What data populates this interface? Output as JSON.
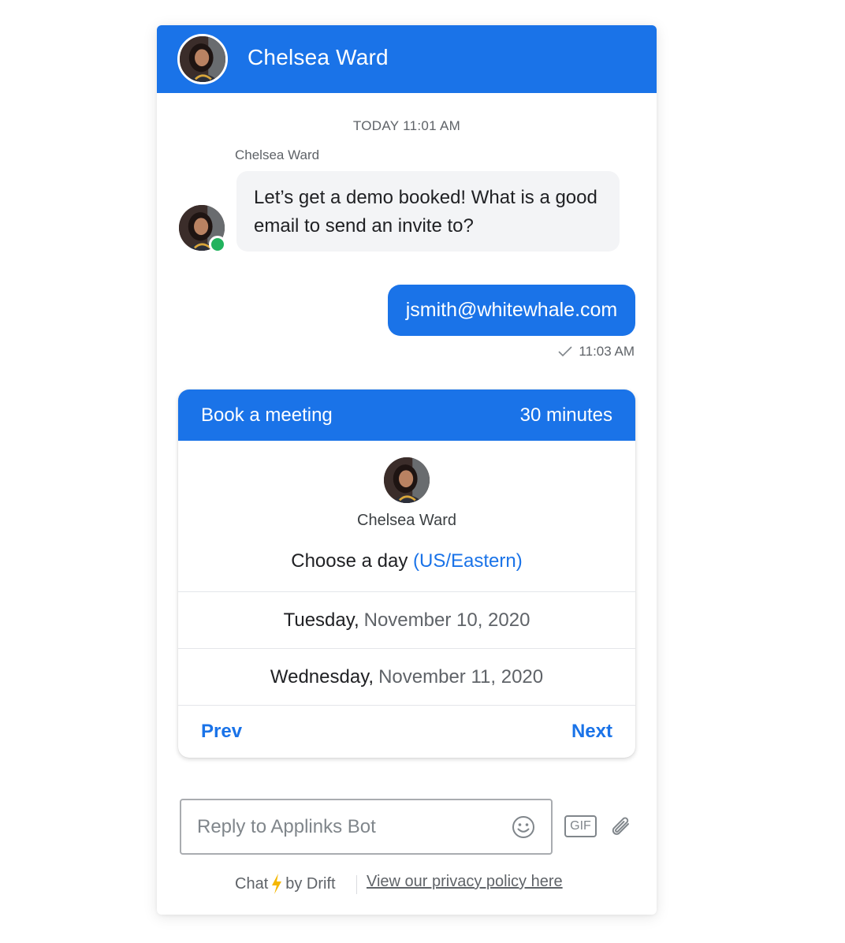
{
  "header": {
    "title": "Chelsea Ward"
  },
  "conversation": {
    "timestamp": "TODAY 11:01 AM",
    "sender_name": "Chelsea Ward",
    "incoming_message": "Let’s get a demo booked! What is a good email to send an invite to?",
    "outgoing_message": "jsmith@whitewhale.com",
    "outgoing_time": "11:03 AM"
  },
  "meeting_card": {
    "title": "Book a meeting",
    "duration": "30 minutes",
    "host_name": "Chelsea Ward",
    "choose_label": "Choose a day",
    "timezone_label": "(US/Eastern)",
    "days": [
      {
        "weekday": "Tuesday,",
        "date": "November 10, 2020"
      },
      {
        "weekday": "Wednesday,",
        "date": "November 11, 2020"
      }
    ],
    "prev_label": "Prev",
    "next_label": "Next"
  },
  "composer": {
    "placeholder": "Reply to Applinks Bot",
    "value": "",
    "gif_label": "GIF",
    "icons": [
      "emoji-icon",
      "gif-icon",
      "attachment-icon"
    ]
  },
  "footer": {
    "brand_prefix": "Chat",
    "brand_suffix": "by Drift",
    "privacy_link": "View our privacy policy here"
  },
  "colors": {
    "brand_blue": "#1a73e8",
    "online_green": "#22b35e",
    "bolt_yellow": "#f5b700"
  }
}
